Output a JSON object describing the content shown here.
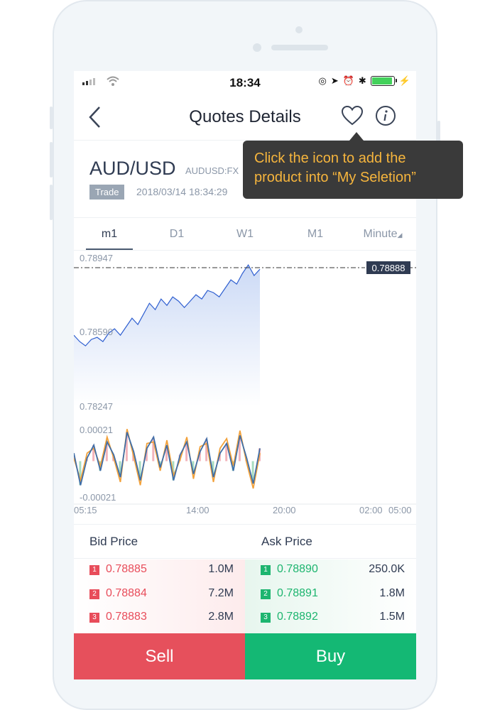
{
  "status_bar": {
    "time": "18:34"
  },
  "nav": {
    "title": "Quotes Details",
    "back_icon": "chevron-left-icon",
    "heart_icon": "heart-icon",
    "info_icon": "info-icon"
  },
  "product": {
    "name": "AUD/USD",
    "code": "AUDUSD:FX",
    "badge": "Trade",
    "timestamp": "2018/03/14 18:34:29"
  },
  "tooltip": {
    "text": "Click the icon to add the product into “My Seletion”"
  },
  "tabs": [
    {
      "label": "m1",
      "active": true
    },
    {
      "label": "D1",
      "active": false
    },
    {
      "label": "W1",
      "active": false
    },
    {
      "label": "M1",
      "active": false
    },
    {
      "label": "Minute",
      "active": false
    }
  ],
  "chart_data": {
    "type": "line",
    "price_labels": [
      "0.78947",
      "0.78590",
      "0.78247"
    ],
    "current_price": "0.78888",
    "indicator_labels": [
      "0.00021",
      "-0.00021"
    ],
    "x_ticks": [
      "05:15",
      "14:00",
      "20:00",
      "02:00",
      "05:00"
    ],
    "ylim": [
      0.78247,
      0.78947
    ],
    "series": [
      {
        "values": [
          0.7858,
          0.7855,
          0.7853,
          0.7856,
          0.7857,
          0.7855,
          0.7859,
          0.7861,
          0.7858,
          0.7862,
          0.7866,
          0.7863,
          0.7868,
          0.7873,
          0.787,
          0.7875,
          0.7872,
          0.7876,
          0.7874,
          0.7871,
          0.7874,
          0.7877,
          0.7875,
          0.7879,
          0.7878,
          0.7876,
          0.788,
          0.7884,
          0.7882,
          0.7887,
          0.7891,
          0.7886,
          0.7889
        ]
      }
    ],
    "indicator": {
      "ylim": [
        -0.00021,
        0.00021
      ],
      "line1": [
        5e-05,
        -0.00015,
        2e-05,
        0.0001,
        -6e-05,
        0.00012,
        4e-05,
        -0.0001,
        0.00018,
        6e-05,
        -0.00012,
        8e-05,
        0.00015,
        -4e-05,
        0.0001,
        -0.00012,
        4e-05,
        0.00012,
        -8e-05,
        6e-05,
        0.00014,
        -0.0001,
        5e-05,
        0.00011,
        -6e-05,
        0.00016,
        2e-05,
        -0.00014,
        8e-05
      ],
      "line2": [
        2e-05,
        -0.00012,
        5e-05,
        8e-05,
        -3e-05,
        0.00015,
        2e-05,
        -0.00013,
        0.0002,
        3e-05,
        -0.00015,
        0.00011,
        0.00012,
        -6e-05,
        0.00013,
        -9e-05,
        1e-05,
        0.00015,
        -0.00011,
        9e-05,
        0.00011,
        -0.00013,
        8e-05,
        0.00014,
        -3e-05,
        0.00019,
        -1e-05,
        -0.00017,
        5e-05
      ]
    }
  },
  "order_book": {
    "bid_header": "Bid Price",
    "ask_header": "Ask Price",
    "bids": [
      {
        "rank": "1",
        "price": "0.78885",
        "volume": "1.0M"
      },
      {
        "rank": "2",
        "price": "0.78884",
        "volume": "7.2M"
      },
      {
        "rank": "3",
        "price": "0.78883",
        "volume": "2.8M"
      }
    ],
    "asks": [
      {
        "rank": "1",
        "price": "0.78890",
        "volume": "250.0K"
      },
      {
        "rank": "2",
        "price": "0.78891",
        "volume": "1.8M"
      },
      {
        "rank": "3",
        "price": "0.78892",
        "volume": "1.5M"
      }
    ]
  },
  "actions": {
    "sell_label": "Sell",
    "buy_label": "Buy"
  },
  "colors": {
    "sell": "#e6505c",
    "buy": "#14b874",
    "tooltip_text": "#f6b53d",
    "price_line": "#2f5fd0"
  }
}
